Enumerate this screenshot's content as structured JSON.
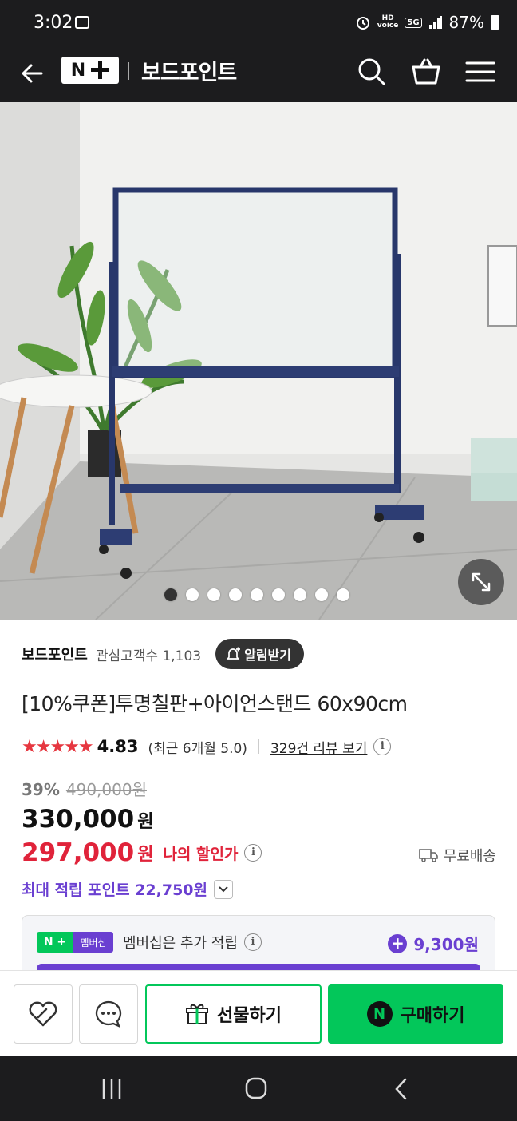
{
  "status_bar": {
    "time": "3:02",
    "battery": "87%",
    "hd_badge": "HD\nvoice",
    "net_badge": "5G"
  },
  "header": {
    "logo_n": "N",
    "store_name": "보드포인트"
  },
  "gallery": {
    "total": 9,
    "active_index": 0
  },
  "store": {
    "name": "보드포인트",
    "fans": "관심고객수 1,103",
    "alarm_label": "알림받기"
  },
  "product": {
    "title": "[10%쿠폰]투명칠판+아이언스탠드 60x90cm",
    "stars": "★★★★★",
    "rating": "4.83",
    "recent_rating": "(최근 6개월 5.0)",
    "reviews": "329건 리뷰 보기",
    "discount_rate": "39%",
    "original_price": "490,000원",
    "sale_price": "330,000",
    "my_price": "297,000",
    "won": "원",
    "my_price_label": "나의 할인가",
    "shipping": "무료배송",
    "max_points": "최대 적립 포인트 22,750원"
  },
  "membership": {
    "logo_n": "N +",
    "logo_label": "멤버십",
    "text": "멤버십은 추가 적립",
    "points": "9,300원"
  },
  "actions": {
    "gift_label": "선물하기",
    "buy_label": "구매하기",
    "npay": "N"
  },
  "colors": {
    "naver_green": "#03c75a",
    "purple": "#6a3fd1",
    "price_red": "#e0233a",
    "dark": "#1c1c1e"
  }
}
